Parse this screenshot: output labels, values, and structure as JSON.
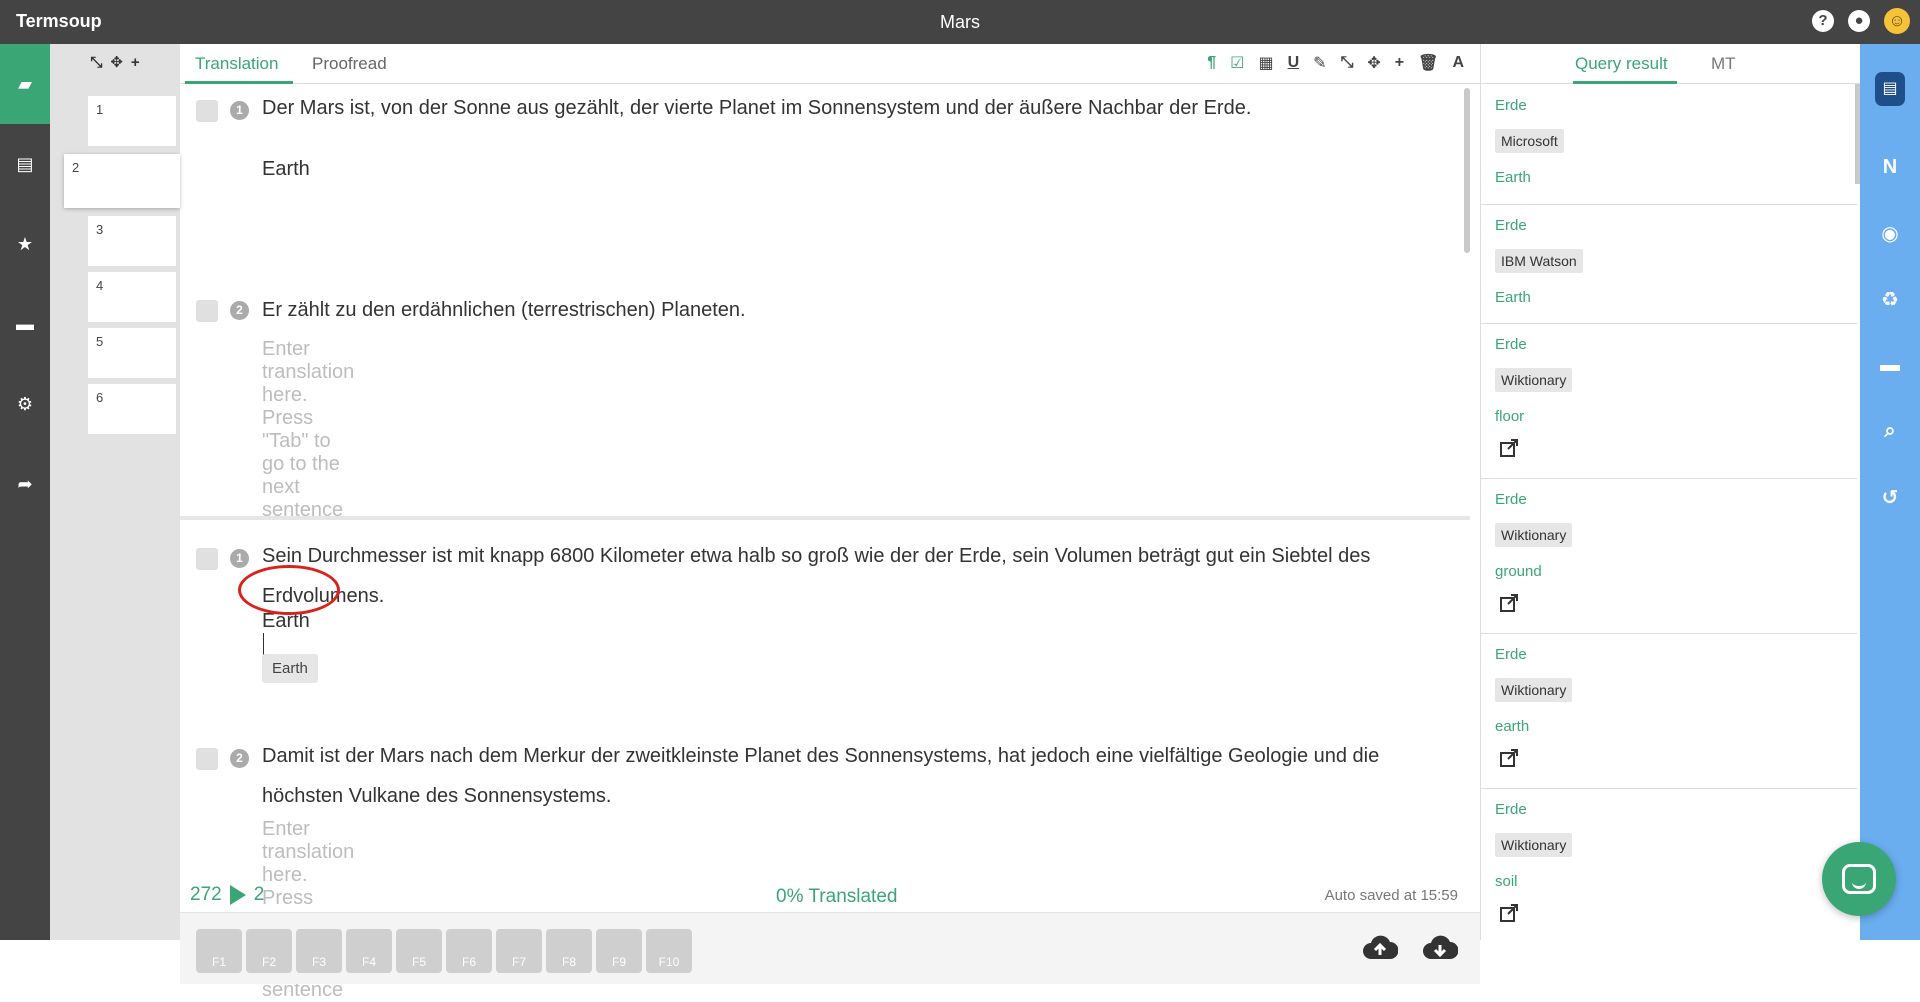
{
  "app": {
    "name": "Termsoup",
    "doc_title": "Mars"
  },
  "title_icons": {
    "help": "?",
    "comments": "●",
    "user": "☺"
  },
  "left_nav": {
    "items": [
      {
        "icon": "folder-open-icon",
        "glyph": "▰",
        "active": true
      },
      {
        "icon": "film-icon",
        "glyph": "▤",
        "active": false
      },
      {
        "icon": "star-icon",
        "glyph": "★",
        "active": false
      },
      {
        "icon": "store-icon",
        "glyph": "▬",
        "active": false
      },
      {
        "icon": "gear-icon",
        "glyph": "⚙",
        "active": false
      },
      {
        "icon": "logout-icon",
        "glyph": "➦",
        "active": false
      }
    ]
  },
  "segments": {
    "tools": [
      "⤡",
      "✥",
      "+"
    ],
    "items": [
      "1",
      "2",
      "3",
      "4",
      "5",
      "6"
    ],
    "active_index": 1
  },
  "editor": {
    "tabs": [
      "Translation",
      "Proofread"
    ],
    "toolbar": [
      "¶",
      "☑",
      "▦",
      "U",
      "✎",
      "⤡",
      "✥",
      "+",
      "🗑",
      "A"
    ],
    "blocks": [
      {
        "sentences": [
          {
            "num": "1",
            "source": "Der Mars ist, von der Sonne aus gezählt, der vierte Planet im Sonnensystem und der äußere Nachbar der Erde.",
            "target": "Earth"
          },
          {
            "num": "2",
            "source": "Er zählt zu den erdähnlichen (terrestrischen) Planeten.",
            "placeholder": "Enter translation here. Press \"Tab\" to go to the next sentence"
          }
        ]
      },
      {
        "sentences": [
          {
            "num": "1",
            "source": "Sein Durchmesser ist mit knapp 6800 Kilometer etwa halb so groß wie der der Erde, sein Volumen beträgt gut ein Siebtel des Erdvolumens.",
            "target": "Earth",
            "suggestion": "Earth"
          },
          {
            "num": "2",
            "source": "Damit ist der Mars nach dem Merkur der zweitkleinste Planet des Sonnensystems, hat jedoch eine vielfältige Geologie und die höchsten Vulkane des Sonnensystems.",
            "placeholder": "Enter translation here. Press \"Tab\" to go to the next sentence"
          }
        ]
      }
    ]
  },
  "status": {
    "count": "272",
    "current": "2",
    "translated": "0% Translated",
    "autosave": "Auto saved at 15:59"
  },
  "fkeys": [
    "F1",
    "F2",
    "F3",
    "F4",
    "F5",
    "F6",
    "F7",
    "F8",
    "F9",
    "F10"
  ],
  "right_panel": {
    "tabs": [
      "Query result",
      "MT"
    ],
    "cards": [
      {
        "term": "Erde",
        "source": "Microsoft",
        "translation": "Earth",
        "external": false
      },
      {
        "term": "Erde",
        "source": "IBM Watson",
        "translation": "Earth",
        "external": false
      },
      {
        "term": "Erde",
        "source": "Wiktionary",
        "translation": "floor",
        "external": true
      },
      {
        "term": "Erde",
        "source": "Wiktionary",
        "translation": "ground",
        "external": true
      },
      {
        "term": "Erde",
        "source": "Wiktionary",
        "translation": "earth",
        "external": true
      },
      {
        "term": "Erde",
        "source": "Wiktionary",
        "translation": "soil",
        "external": true
      }
    ]
  },
  "far_right": {
    "items": [
      {
        "icon": "document-icon",
        "glyph": "▤"
      },
      {
        "icon": "n-icon",
        "glyph": "N"
      },
      {
        "icon": "eye-icon",
        "glyph": "◉"
      },
      {
        "icon": "recycle-icon",
        "glyph": "♻"
      },
      {
        "icon": "comment-icon",
        "glyph": "▬"
      },
      {
        "icon": "search-icon",
        "glyph": "⌕"
      },
      {
        "icon": "history-icon",
        "glyph": "↺"
      }
    ]
  },
  "colors": {
    "accent": "#3aa676",
    "dark": "#444444",
    "sidebar_blue": "#6aaef0",
    "highlight_circle": "#d9221c"
  }
}
